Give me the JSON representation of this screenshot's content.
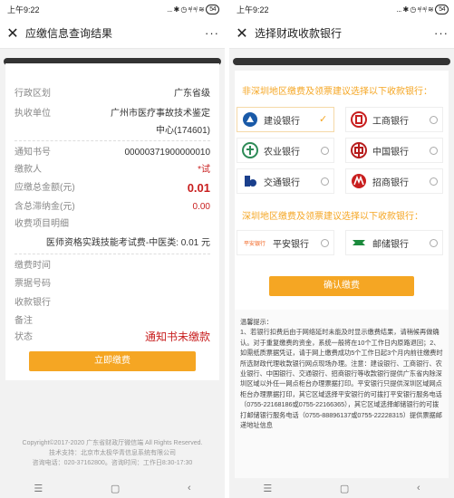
{
  "left": {
    "status": {
      "time": "上午9:22",
      "icons": "... ✱ ◷ ᵃᵢˡ ᵃᵢˡ ≋",
      "battery": "54"
    },
    "nav": {
      "title": "应缴信息查询结果",
      "more": "···"
    },
    "fields": [
      {
        "k": "行政区划",
        "v": "广东省级"
      },
      {
        "k": "执收单位",
        "v": "广州市医疗事故技术鉴定"
      },
      {
        "k": "",
        "v": "中心(174601)"
      },
      {
        "k": "通知书号",
        "v": "00000371900000010"
      },
      {
        "k": "缴款人",
        "v": "*试"
      },
      {
        "k": "应缴总金额(元)",
        "v": "0.01"
      },
      {
        "k": "含总滞纳金(元)",
        "v": "0.00"
      },
      {
        "k": "收费项目明细",
        "v": ""
      },
      {
        "k": "",
        "v": "医师资格实践技能考试费-中医类: 0.01 元"
      },
      {
        "k": "缴费时间",
        "v": ""
      },
      {
        "k": "票据号码",
        "v": ""
      },
      {
        "k": "收款银行",
        "v": ""
      },
      {
        "k": "备注",
        "v": ""
      },
      {
        "k": "状态",
        "v": "通知书未缴款"
      }
    ],
    "pay_button": "立即缴费",
    "footer": [
      "Copyright©2017-2020 广东省财政厅微信端 All Rights Reserved.",
      "技术支持：北京市太极华青信息系统有限公司",
      "咨询电话：020-37162800。咨询时间：工作日8:30-17:30"
    ]
  },
  "right": {
    "status": {
      "time": "上午9:22",
      "icons": "... ✱ ◷ ᵃᵢˡ ᵃᵢˡ ≋",
      "battery": "54"
    },
    "nav": {
      "title": "选择财政收款银行",
      "more": "···"
    },
    "section1": "非深圳地区缴费及领票建议选择以下收款银行：",
    "banks1": [
      {
        "name": "建设银行",
        "icon": "ccb-icon",
        "color": "#1a5aa8",
        "selected": true
      },
      {
        "name": "工商银行",
        "icon": "icbc-icon",
        "color": "#c81e1e",
        "selected": false
      },
      {
        "name": "农业银行",
        "icon": "abc-icon",
        "color": "#2e8b57",
        "selected": false
      },
      {
        "name": "中国银行",
        "icon": "boc-icon",
        "color": "#b71c1c",
        "selected": false
      },
      {
        "name": "交通银行",
        "icon": "bocom-icon",
        "color": "#1a3f8c",
        "selected": false
      },
      {
        "name": "招商银行",
        "icon": "cmb-icon",
        "color": "#c81e1e",
        "selected": false
      }
    ],
    "section2": "深圳地区缴费及领票建议选择以下收款银行：",
    "banks2": [
      {
        "name": "平安银行",
        "icon": "pingan-icon",
        "color": "#f26522",
        "selected": false,
        "logo_text": "平安银行"
      },
      {
        "name": "邮储银行",
        "icon": "psbc-icon",
        "color": "#1b8a3c",
        "selected": false
      }
    ],
    "confirm_button": "确认缴费",
    "tips": "温馨提示：\n1、若银行扣费后由于网络延时未能及时显示缴费结果，请稍候再做确认。对于重复缴费的资金，系统一般将在10个工作日内原路退回；2、如需纸质票据凭证，请于网上缴费成功5个工作日起3个月内前往缴费时所选财政代理收款银行网点现场办理。注意：建设银行、工商银行、农业银行、中国银行、交通银行、招商银行等收款银行提供广东省内除深圳区域以外任一网点柜台办理票据打印。平安银行只提供深圳区域网点柜台办理票据打印，其它区域选择平安银行的可拨打平安银行服务电话（0755-22168186或0755-22166365），其它区域选择邮储银行的可拨打邮储银行服务电话（0755-88896137或0755-22228315）提供票据邮递地址信息"
  },
  "sysnav": {
    "menu": "☰",
    "home": "▢",
    "back": "‹"
  }
}
